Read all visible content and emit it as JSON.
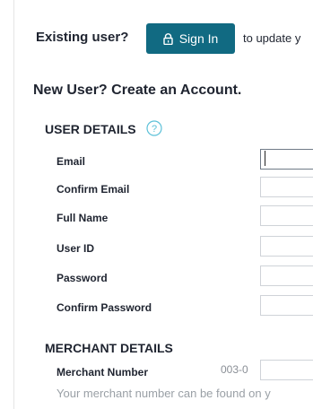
{
  "existing": {
    "label": "Existing user?",
    "signin_label": "Sign In",
    "update_text": "to update y"
  },
  "heading": "New User? Create an Account.",
  "user_details": {
    "title": "USER DETAILS",
    "fields": [
      {
        "label": "Email",
        "value": ""
      },
      {
        "label": "Confirm Email",
        "value": ""
      },
      {
        "label": "Full Name",
        "value": ""
      },
      {
        "label": "User ID",
        "value": ""
      },
      {
        "label": "Password",
        "value": ""
      },
      {
        "label": "Confirm Password",
        "value": ""
      }
    ]
  },
  "merchant_details": {
    "title": "MERCHANT DETAILS",
    "number_label": "Merchant Number",
    "number_prefix": "003-0",
    "hint": "Your merchant number can be found on y"
  },
  "colors": {
    "accent": "#116a82",
    "help": "#5bc0d8"
  }
}
